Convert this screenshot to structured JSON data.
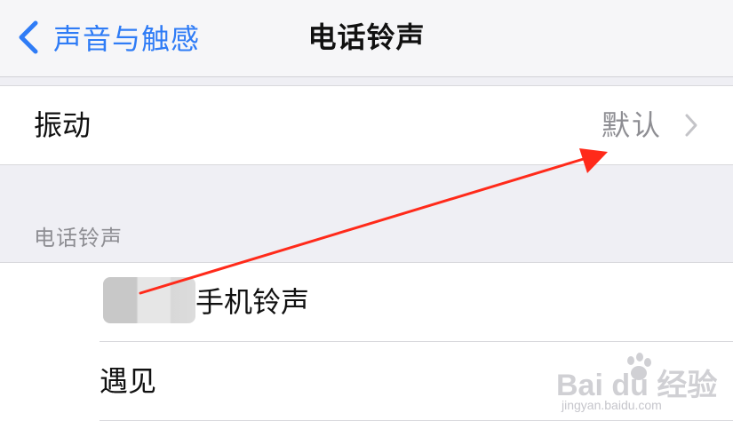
{
  "nav": {
    "back_label": "声音与触感",
    "title": "电话铃声"
  },
  "vibration": {
    "label": "振动",
    "value": "默认"
  },
  "section": {
    "header": "电话铃声"
  },
  "ringtones": [
    {
      "label": "手机铃声"
    },
    {
      "label": "遇见"
    }
  ],
  "watermark": {
    "text": "Bai du 经验",
    "url": "jingyan.baidu.com"
  },
  "colors": {
    "accent": "#2f7cf6",
    "annotation_arrow": "#ff2a1a",
    "background": "#efeff4"
  },
  "icons": {
    "back": "chevron-left-icon",
    "disclosure": "chevron-right-icon"
  }
}
